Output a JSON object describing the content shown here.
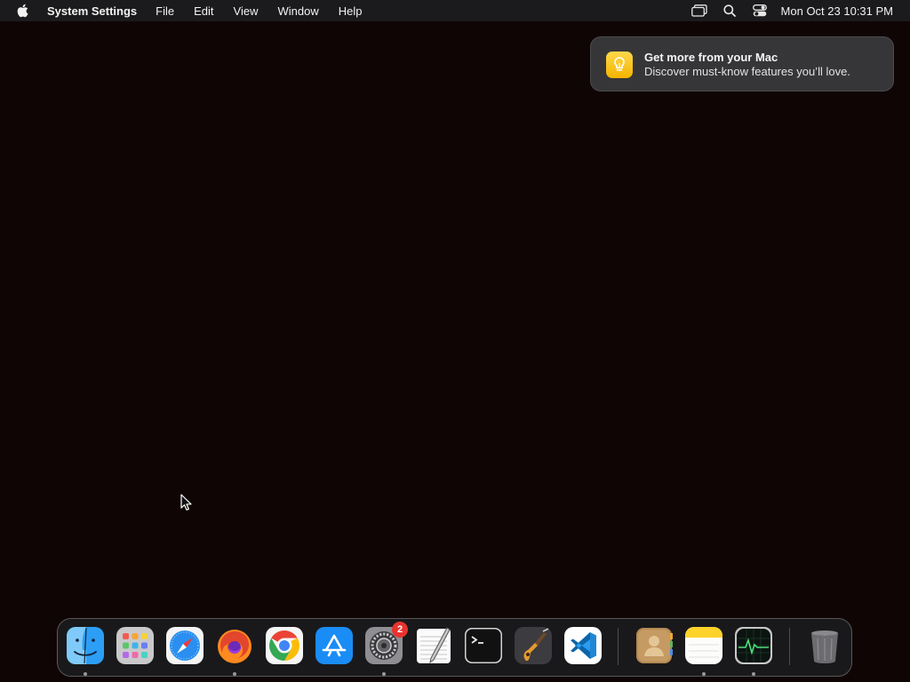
{
  "menubar": {
    "apple_icon": "apple-logo-icon",
    "app_name": "System Settings",
    "menus": [
      "File",
      "Edit",
      "View",
      "Window",
      "Help"
    ],
    "status_icons": [
      "screen-mirroring-icon",
      "spotlight-search-icon",
      "control-center-icon"
    ],
    "clock": "Mon Oct 23  10:31 PM"
  },
  "notification": {
    "icon": "lightbulb-icon",
    "title": "Get more from your Mac",
    "body": "Discover must-know features you’ll love.",
    "accent_color": "#f8c61d"
  },
  "dock": {
    "apps": [
      {
        "name": "Finder",
        "icon": "finder-icon",
        "running": true
      },
      {
        "name": "Launchpad",
        "icon": "launchpad-icon",
        "running": false
      },
      {
        "name": "Safari",
        "icon": "safari-icon",
        "running": false
      },
      {
        "name": "Firefox",
        "icon": "firefox-icon",
        "running": true
      },
      {
        "name": "Google Chrome",
        "icon": "chrome-icon",
        "running": false
      },
      {
        "name": "App Store",
        "icon": "app-store-icon",
        "running": false
      },
      {
        "name": "System Settings",
        "icon": "system-settings-icon",
        "running": true,
        "badge": "2"
      },
      {
        "name": "TextEdit",
        "icon": "textedit-icon",
        "running": false
      },
      {
        "name": "Terminal",
        "icon": "terminal-icon",
        "running": false
      },
      {
        "name": "GarageBand",
        "icon": "garageband-icon",
        "running": false
      },
      {
        "name": "Visual Studio Code",
        "icon": "vscode-icon",
        "running": false
      },
      {
        "name": "Contacts",
        "icon": "contacts-icon",
        "running": false
      },
      {
        "name": "Notes",
        "icon": "notes-icon",
        "running": true
      },
      {
        "name": "Activity Monitor",
        "icon": "activity-monitor-icon",
        "running": true
      },
      {
        "name": "Trash",
        "icon": "trash-icon",
        "running": false
      }
    ],
    "badge_color": "#e8332f"
  }
}
